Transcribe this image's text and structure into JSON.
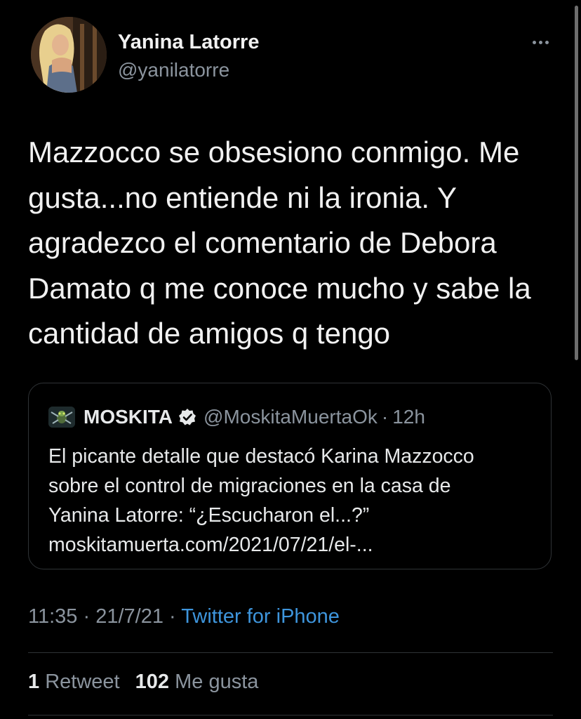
{
  "author": {
    "name": "Yanina Latorre",
    "handle": "@yanilatorre",
    "avatar_icon": "profile-photo"
  },
  "tweet": {
    "text": "Mazzocco se obsesiono conmigo. Me\ngusta...no entiende ni la ironia. Y\nagradezco el comentario de Debora\nDamato q me conoce mucho y sabe la\ncantidad de amigos q tengo"
  },
  "quote": {
    "name": "MOSKITA",
    "handle": "@MoskitaMuertaOk",
    "separator": "·",
    "time": "12h",
    "verified_icon": "verified-badge-icon",
    "body_lines": [
      "El picante detalle que destacó Karina Mazzocco",
      "sobre el control de migraciones en la casa de",
      "Yanina Latorre: “¿Escucharon el...?”",
      "moskitamuerta.com/2021/07/21/el-..."
    ]
  },
  "meta": {
    "time": "11:35",
    "date": "21/7/21",
    "separator": "·",
    "source": "Twitter for iPhone"
  },
  "stats": {
    "retweets_count": "1",
    "retweets_label": "Retweet",
    "likes_count": "102",
    "likes_label": "Me gusta"
  },
  "colors": {
    "background": "#000000",
    "text": "#e7e9ea",
    "secondary": "#8b949e",
    "link": "#3e95dc",
    "border": "#2f3336"
  }
}
